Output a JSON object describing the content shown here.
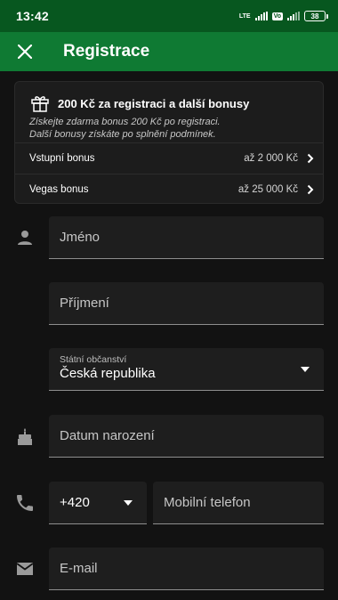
{
  "status_bar": {
    "time": "13:42",
    "network": "LTE",
    "volte": "Vo",
    "battery": "38",
    "icons": [
      "signal-icon",
      "signal-icon",
      "battery-icon"
    ]
  },
  "app_bar": {
    "close_icon": "close-icon",
    "title": "Registrace"
  },
  "bonus": {
    "icon": "gift-icon",
    "title": "200 Kč za registraci a další bonusy",
    "desc_line1": "Získejte zdarma bonus 200 Kč po registraci.",
    "desc_line2": "Další bonusy získáte po splnění podmínek.",
    "rows": [
      {
        "label": "Vstupní bonus",
        "value": "až 2 000 Kč"
      },
      {
        "label": "Vegas bonus",
        "value": "až 25 000 Kč"
      }
    ]
  },
  "form": {
    "first_name_placeholder": "Jméno",
    "last_name_placeholder": "Příjmení",
    "citizenship_label": "Státní občanství",
    "citizenship_value": "Česká republika",
    "birth_date_placeholder": "Datum narození",
    "phone_prefix": "+420",
    "phone_placeholder": "Mobilní telefon",
    "email_placeholder": "E-mail",
    "icons": [
      "person-icon",
      "cake-icon",
      "phone-icon",
      "email-icon"
    ]
  },
  "colors": {
    "status_bar": "#07571f",
    "app_bar": "#0f7a33",
    "background": "#121212",
    "field": "#1e1e1e"
  }
}
